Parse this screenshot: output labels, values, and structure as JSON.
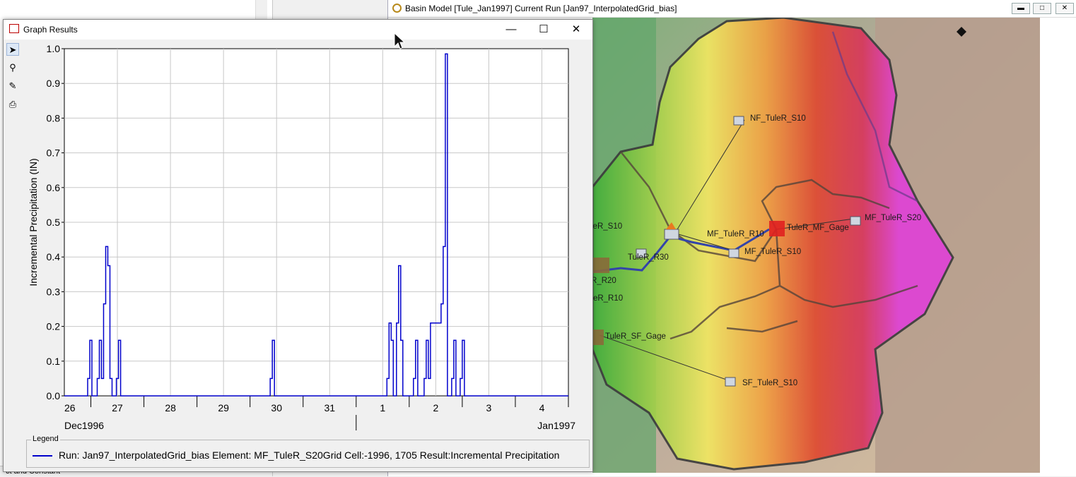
{
  "background_window": {
    "bottom_text": "ct and Constant"
  },
  "basin_window": {
    "title": "Basin Model [Tule_Jan1997] Current Run [Jan97_InterpolatedGrid_bias]",
    "map_labels": {
      "nf_s10": "NF_TuleR_S10",
      "mf_s20": "MF_TuleR_S20",
      "mf_gage": "TuleR_MF_Gage",
      "mf_r10": "MF_TuleR_R10",
      "mf_s10": "MF_TuleR_S10",
      "r30": "TuleR_R30",
      "r20": "R_R20",
      "s10": "leR_S10",
      "r10": "uleR_R10",
      "sf_gage": "TuleR_SF_Gage",
      "sf_s10": "SF_TuleR_S10"
    },
    "icons": [
      "restore-icon",
      "maximize-icon",
      "close-icon"
    ]
  },
  "graph_window": {
    "title": "Graph Results",
    "toolbar": [
      "pointer-icon",
      "zoom-icon",
      "properties-icon",
      "print-icon"
    ],
    "legend": {
      "title": "Legend",
      "entry": "Run: Jan97_InterpolatedGrid_bias Element: MF_TuleR_S20Grid Cell:-1996, 1705 Result:Incremental Precipitation",
      "color": "#0000cc"
    }
  },
  "chart_data": {
    "type": "line",
    "step": true,
    "ylabel": "Incremental Precipitation (IN)",
    "ylim": [
      0,
      1.0
    ],
    "yticks": [
      "0.0",
      "0.1",
      "0.2",
      "0.3",
      "0.4",
      "0.5",
      "0.6",
      "0.7",
      "0.8",
      "0.9",
      "1.0"
    ],
    "xlim": [
      0,
      9.5
    ],
    "xticks": [
      {
        "x": 0,
        "label": "26"
      },
      {
        "x": 1,
        "label": "27"
      },
      {
        "x": 2,
        "label": "28"
      },
      {
        "x": 3,
        "label": "29"
      },
      {
        "x": 4,
        "label": "30"
      },
      {
        "x": 5,
        "label": "31"
      },
      {
        "x": 6,
        "label": "1"
      },
      {
        "x": 7,
        "label": "2"
      },
      {
        "x": 8,
        "label": "3"
      },
      {
        "x": 9,
        "label": "4"
      }
    ],
    "period_labels": {
      "left": "Dec1996",
      "right": "Jan1997"
    },
    "grid": true,
    "series": [
      {
        "color": "#0000cc",
        "points": [
          [
            0,
            0
          ],
          [
            0.44,
            0
          ],
          [
            0.44,
            0.05
          ],
          [
            0.48,
            0.05
          ],
          [
            0.48,
            0.16
          ],
          [
            0.52,
            0.16
          ],
          [
            0.52,
            0
          ],
          [
            0.62,
            0
          ],
          [
            0.62,
            0.05
          ],
          [
            0.66,
            0.05
          ],
          [
            0.66,
            0.16
          ],
          [
            0.7,
            0.16
          ],
          [
            0.7,
            0.05
          ],
          [
            0.74,
            0.05
          ],
          [
            0.74,
            0.265
          ],
          [
            0.78,
            0.265
          ],
          [
            0.78,
            0.43
          ],
          [
            0.82,
            0.43
          ],
          [
            0.82,
            0.375
          ],
          [
            0.86,
            0.375
          ],
          [
            0.86,
            0.05
          ],
          [
            0.9,
            0.05
          ],
          [
            0.9,
            0
          ],
          [
            0.98,
            0
          ],
          [
            0.98,
            0.05
          ],
          [
            1.02,
            0.05
          ],
          [
            1.02,
            0.16
          ],
          [
            1.06,
            0.16
          ],
          [
            1.06,
            0
          ],
          [
            3.88,
            0
          ],
          [
            3.88,
            0.05
          ],
          [
            3.92,
            0.05
          ],
          [
            3.92,
            0.16
          ],
          [
            3.96,
            0.16
          ],
          [
            3.96,
            0
          ],
          [
            6.08,
            0
          ],
          [
            6.08,
            0.05
          ],
          [
            6.12,
            0.05
          ],
          [
            6.12,
            0.21
          ],
          [
            6.16,
            0.21
          ],
          [
            6.16,
            0.16
          ],
          [
            6.2,
            0.16
          ],
          [
            6.2,
            0
          ],
          [
            6.26,
            0
          ],
          [
            6.26,
            0.21
          ],
          [
            6.3,
            0.21
          ],
          [
            6.3,
            0.375
          ],
          [
            6.34,
            0.375
          ],
          [
            6.34,
            0.16
          ],
          [
            6.38,
            0.16
          ],
          [
            6.38,
            0
          ],
          [
            6.58,
            0
          ],
          [
            6.58,
            0.05
          ],
          [
            6.62,
            0.05
          ],
          [
            6.62,
            0.16
          ],
          [
            6.66,
            0.16
          ],
          [
            6.66,
            0
          ],
          [
            6.78,
            0
          ],
          [
            6.78,
            0.05
          ],
          [
            6.82,
            0.05
          ],
          [
            6.82,
            0.16
          ],
          [
            6.86,
            0.16
          ],
          [
            6.86,
            0.05
          ],
          [
            6.9,
            0.05
          ],
          [
            6.9,
            0.21
          ],
          [
            7.1,
            0.21
          ],
          [
            7.1,
            0.265
          ],
          [
            7.14,
            0.265
          ],
          [
            7.14,
            0.43
          ],
          [
            7.18,
            0.43
          ],
          [
            7.18,
            0.985
          ],
          [
            7.22,
            0.985
          ],
          [
            7.22,
            0
          ],
          [
            7.3,
            0
          ],
          [
            7.3,
            0.05
          ],
          [
            7.34,
            0.05
          ],
          [
            7.34,
            0.16
          ],
          [
            7.38,
            0.16
          ],
          [
            7.38,
            0
          ],
          [
            7.46,
            0
          ],
          [
            7.46,
            0.05
          ],
          [
            7.5,
            0.05
          ],
          [
            7.5,
            0.16
          ],
          [
            7.54,
            0.16
          ],
          [
            7.54,
            0
          ],
          [
            9.5,
            0
          ]
        ]
      }
    ]
  }
}
